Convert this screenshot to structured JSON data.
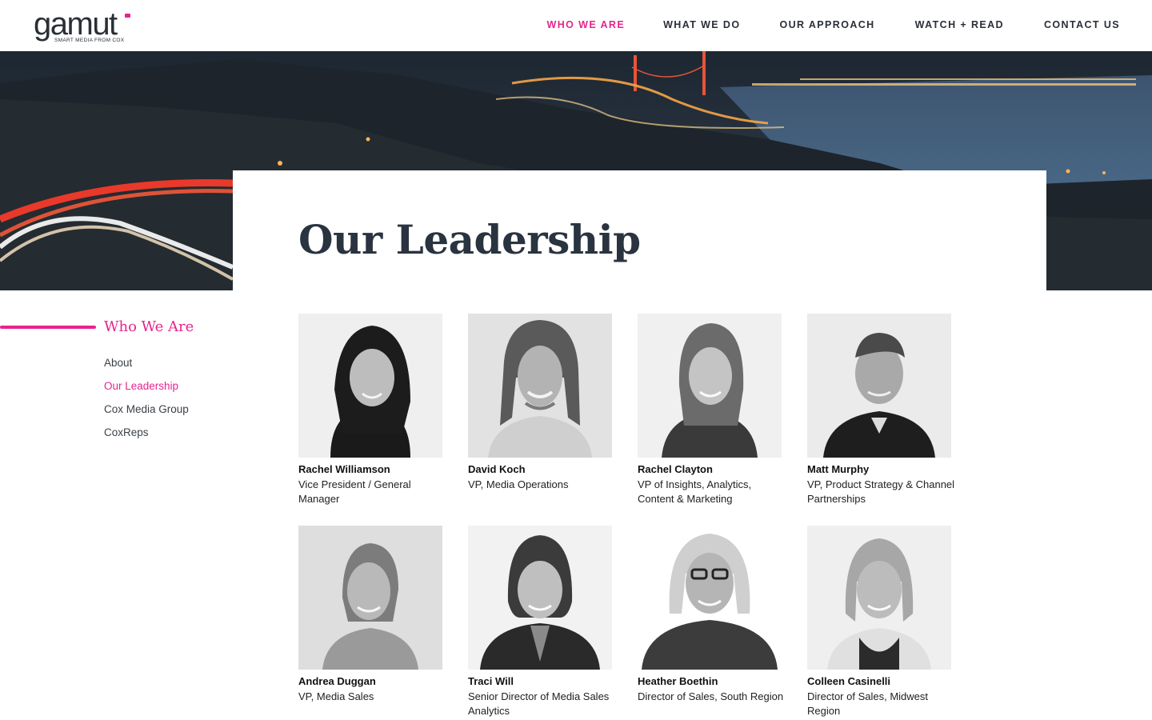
{
  "brand": {
    "logo_text": "gamut",
    "tagline": "SMART MEDIA FROM COX",
    "accent": "#e6248f"
  },
  "nav": {
    "items": [
      {
        "label": "WHO WE ARE",
        "active": true
      },
      {
        "label": "WHAT WE DO",
        "active": false
      },
      {
        "label": "OUR APPROACH",
        "active": false
      },
      {
        "label": "WATCH + READ",
        "active": false
      },
      {
        "label": "CONTACT US",
        "active": false
      }
    ]
  },
  "page": {
    "title": "Our Leadership"
  },
  "sidebar": {
    "heading": "Who We Are",
    "items": [
      {
        "label": "About",
        "active": false
      },
      {
        "label": "Our Leadership",
        "active": true
      },
      {
        "label": "Cox Media Group",
        "active": false
      },
      {
        "label": "CoxReps",
        "active": false
      }
    ]
  },
  "team": [
    {
      "name": "Rachel Williamson",
      "role": "Vice President / General Manager"
    },
    {
      "name": "David Koch",
      "role": "VP, Media Operations"
    },
    {
      "name": "Rachel Clayton",
      "role": "VP of Insights, Analytics, Content & Marketing"
    },
    {
      "name": "Matt Murphy",
      "role": "VP, Product Strategy & Channel Partnerships"
    },
    {
      "name": "Andrea Duggan",
      "role": "VP, Media Sales"
    },
    {
      "name": "Traci Will",
      "role": "Senior Director of Media Sales Analytics"
    },
    {
      "name": "Heather Boethin",
      "role": "Director of Sales, South Region"
    },
    {
      "name": "Colleen Casinelli",
      "role": "Director of Sales, Midwest Region"
    }
  ]
}
